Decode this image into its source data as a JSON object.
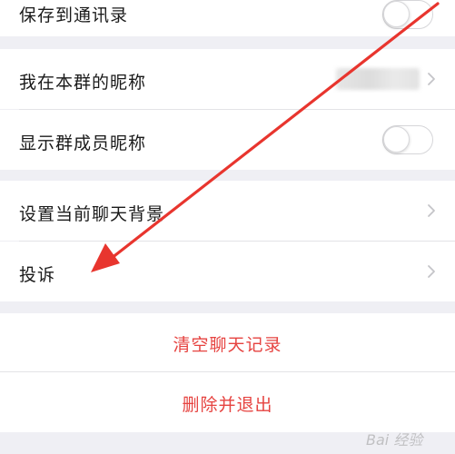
{
  "settings": {
    "group1": {
      "save_to_contacts_label": "保存到通讯录",
      "save_to_contacts_on": false
    },
    "group2": {
      "my_group_nickname_label": "我在本群的昵称",
      "my_group_nickname_value_hidden": true,
      "show_member_nicknames_label": "显示群成员昵称",
      "show_member_nicknames_on": false
    },
    "group3": {
      "set_chat_background_label": "设置当前聊天背景",
      "complaint_label": "投诉"
    }
  },
  "actions": {
    "clear_chat_history_label": "清空聊天记录",
    "delete_and_exit_label": "删除并退出"
  },
  "colors": {
    "danger": "#e64340",
    "annotation_arrow": "#e8352e",
    "background": "#efeff4"
  },
  "watermark": {
    "text": "Bai 经验"
  }
}
